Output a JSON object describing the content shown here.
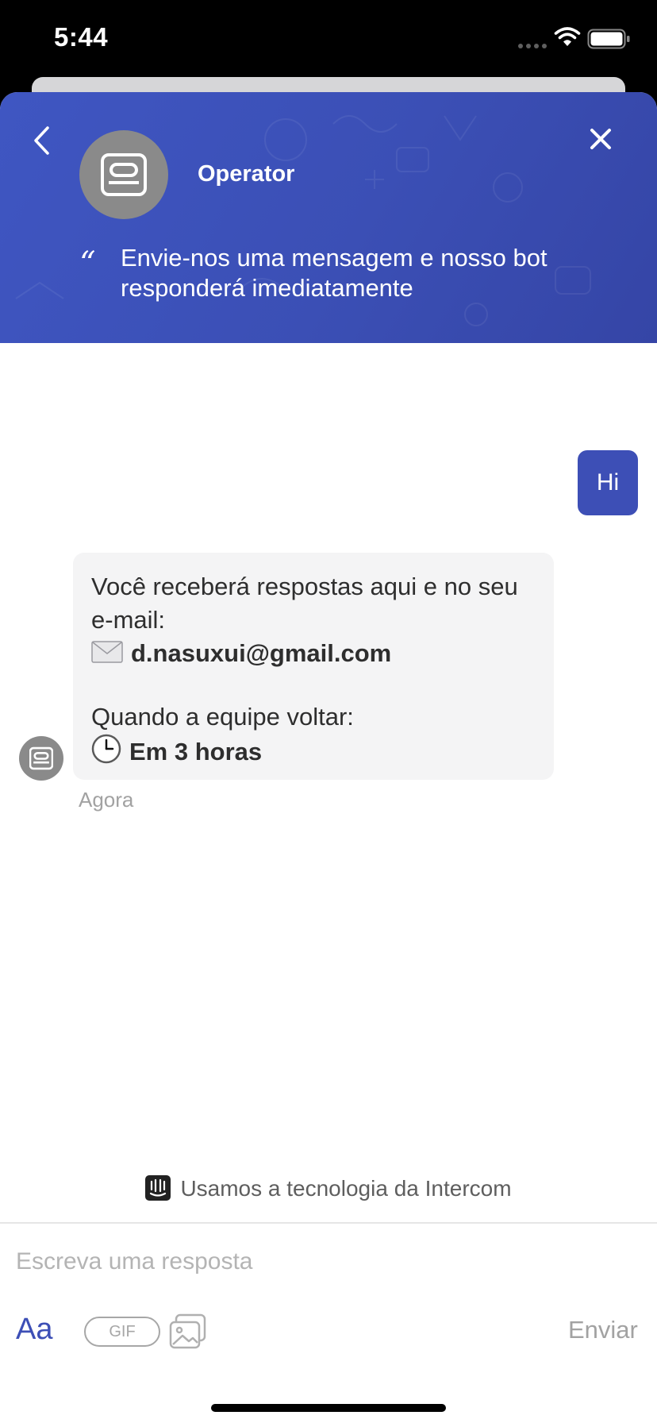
{
  "status_bar": {
    "time": "5:44"
  },
  "header": {
    "operator_name": "Operator",
    "intro": "Envie-nos uma mensagem e nosso bot responderá imediatamente",
    "accent_color": "#3d4fb6"
  },
  "conversation": {
    "user_message": "Hi",
    "bot_message": {
      "line1": "Você receberá respostas aqui e no seu e-mail:",
      "email": "d.nasuxui@gmail.com",
      "line2": "Quando a equipe voltar:",
      "response_time": "Em 3 horas",
      "timestamp": "Agora"
    }
  },
  "footer": {
    "powered_by": "Usamos a tecnologia da Intercom"
  },
  "composer": {
    "placeholder": "Escreva uma resposta",
    "format_label": "Aa",
    "gif_label": "GIF",
    "send_label": "Enviar"
  }
}
